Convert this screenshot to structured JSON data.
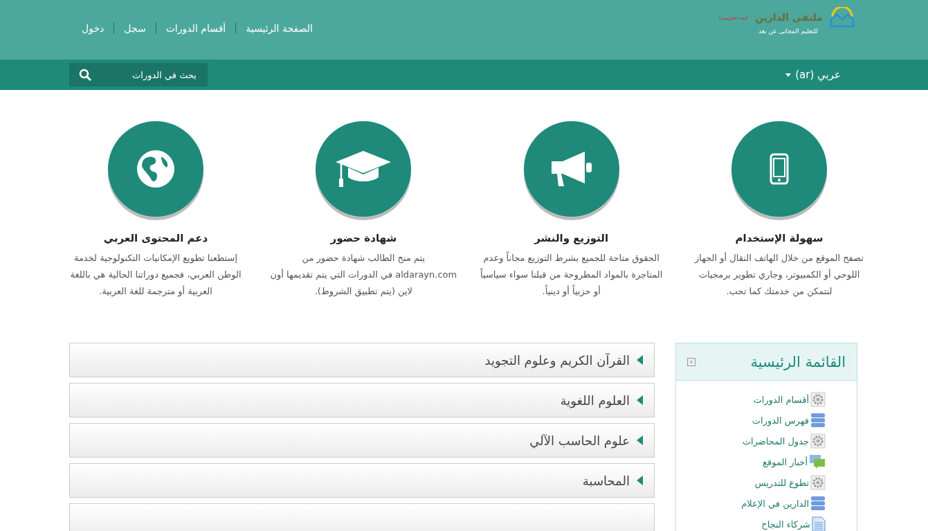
{
  "logo": {
    "name": "ملتقى الدارين",
    "tagline": "للتعليم المجانى عن بعد",
    "badge": "(بث تجريبى)"
  },
  "nav": [
    "الصفحة الرئيسية",
    "أقسام الدورات",
    "سجل",
    "دخول"
  ],
  "language": {
    "label": "عربي (ar)"
  },
  "search": {
    "placeholder": "بحث في الدورات"
  },
  "features": [
    {
      "kind": "phone",
      "title": "سهولة الإستخدام",
      "text": "تصفح الموقع من خلال الهاتف النقال أو الجهاز اللوحي أو الكمبيوتر، وجاري تطوير برمجيات لنتمكن من خدمتك كما تحب."
    },
    {
      "kind": "megaphone",
      "title": "التوزيع والنشر",
      "text": "الحقوق متاحة للجميع بشرط التوزيع مجاناً وعدم المتاجرة بالمواد المطروحة من قبلنا سواء سياسياً أو حزبياً أو دينياً."
    },
    {
      "kind": "cap",
      "title": "شهادة حضور",
      "text": "يتم منح الطالب شهادة حضور من aldarayn.com في الدورات التي يتم تقديمها أون لاين (يتم تطبيق الشروط)."
    },
    {
      "kind": "globe",
      "title": "دعم المحتوى العربي",
      "text": "إستطعنا تطويع الإمكانيات التكنولوجية لخدمة الوطن العربي، فجميع دوراتنا الحالية هي باللغة العربية أو مترجمة للغة العربية."
    }
  ],
  "main_menu": {
    "title": "القائمة الرئيسية",
    "items": [
      {
        "kind": "gear",
        "label": "أقسام الدورات"
      },
      {
        "kind": "list",
        "label": "فهرس الدورات"
      },
      {
        "kind": "gear",
        "label": "جدول المحاضرات"
      },
      {
        "kind": "chat",
        "label": "أخبار الموقع"
      },
      {
        "kind": "gear",
        "label": "تطوع للتدريس"
      },
      {
        "kind": "list",
        "label": "الدارين في الإعلام"
      },
      {
        "kind": "page",
        "label": "شركاء النجاح"
      }
    ]
  },
  "categories": [
    {
      "label": "القرآن الكريم وعلوم التجويد",
      "expanded": false
    },
    {
      "label": "العلوم اللغوية",
      "expanded": false
    },
    {
      "label": "علوم الحاسب الآلي",
      "expanded": false
    },
    {
      "label": "المحاسبة",
      "expanded": false
    }
  ]
}
